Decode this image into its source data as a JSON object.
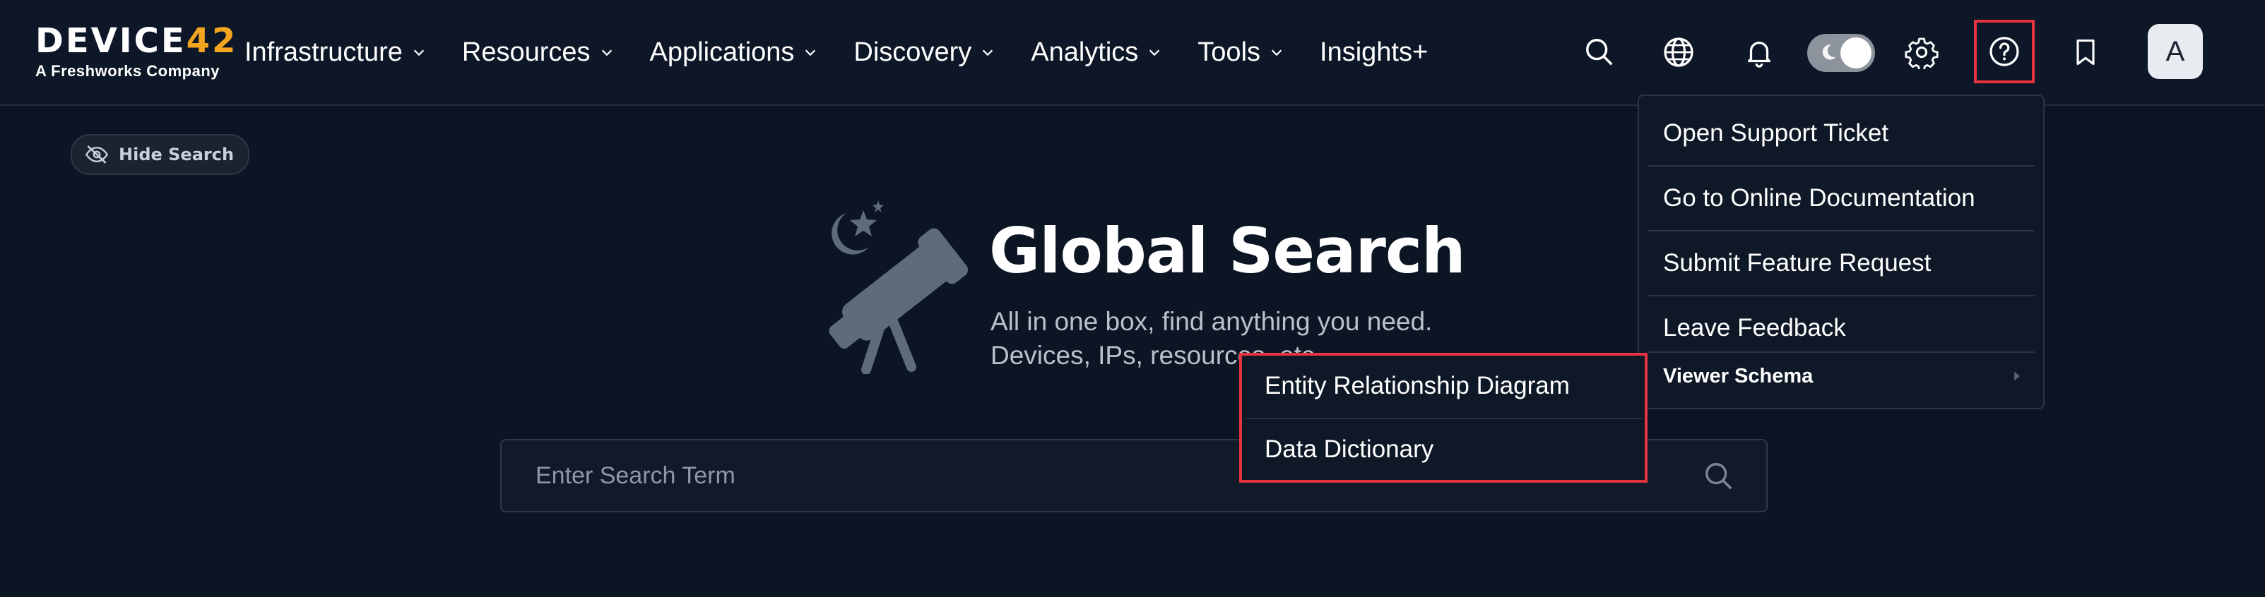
{
  "brand": {
    "logo_main": "DEVICE",
    "logo_accent": "42",
    "logo_sub": "A Freshworks Company",
    "accent_color": "#f3a51f"
  },
  "nav": [
    {
      "label": "Infrastructure",
      "has_dropdown": true
    },
    {
      "label": "Resources",
      "has_dropdown": true
    },
    {
      "label": "Applications",
      "has_dropdown": true
    },
    {
      "label": "Discovery",
      "has_dropdown": true
    },
    {
      "label": "Analytics",
      "has_dropdown": true
    },
    {
      "label": "Tools",
      "has_dropdown": true
    },
    {
      "label": "Insights+",
      "has_dropdown": false
    }
  ],
  "toolbar_icons": [
    "search-icon",
    "globe-icon",
    "bell-icon",
    "theme-toggle",
    "gear-icon",
    "help-icon",
    "bookmark-icon"
  ],
  "user": {
    "avatar_initial": "A"
  },
  "hide_search": {
    "label": "Hide Search"
  },
  "hero": {
    "title": "Global Search",
    "subtitle_line1": "All in one box, find anything you need.",
    "subtitle_line2": "Devices, IPs, resources, etc."
  },
  "search": {
    "placeholder": "Enter Search Term",
    "value": ""
  },
  "help_menu": {
    "items": [
      {
        "label": "Open Support Ticket"
      },
      {
        "label": "Go to Online Documentation"
      },
      {
        "label": "Submit Feature Request"
      },
      {
        "label": "Leave Feedback"
      },
      {
        "label": "Viewer Schema",
        "has_submenu": true
      }
    ]
  },
  "viewer_schema_submenu": {
    "items": [
      {
        "label": "Entity Relationship Diagram"
      },
      {
        "label": "Data Dictionary"
      }
    ]
  },
  "colors": {
    "background": "#0c1524",
    "highlight": "#e5333f"
  }
}
